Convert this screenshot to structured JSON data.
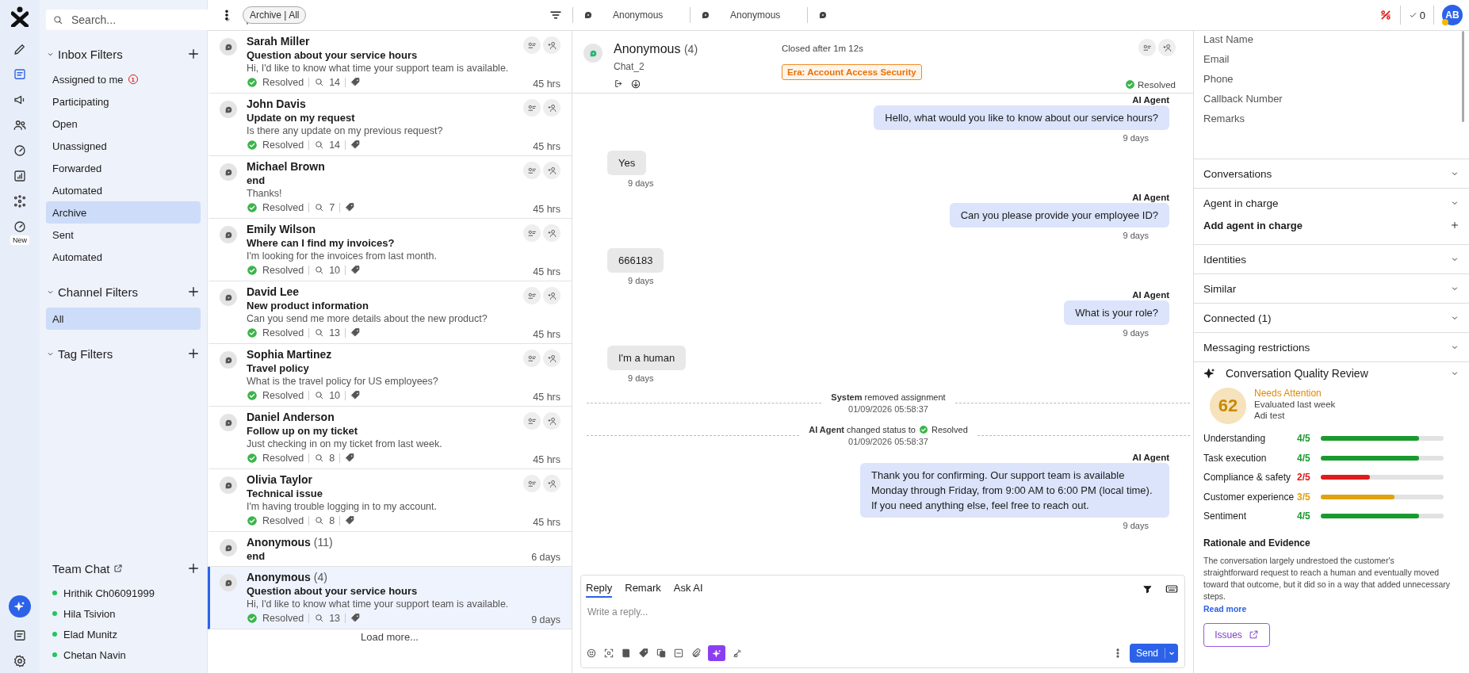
{
  "rail": {
    "items": [
      {
        "selected": false
      },
      {
        "selected": true
      },
      {
        "selected": false
      },
      {
        "selected": false
      },
      {
        "selected": false
      },
      {
        "selected": false
      },
      {
        "selected": false
      },
      {
        "selected": false,
        "badge": "New"
      }
    ]
  },
  "sidebar": {
    "search": {
      "placeholder": "Search..."
    },
    "sections": [
      {
        "title": "Inbox Filters",
        "items": [
          {
            "label": "Assigned to me",
            "badge": "1",
            "selected": false
          },
          {
            "label": "Participating",
            "selected": false
          },
          {
            "label": "Open",
            "selected": false
          },
          {
            "label": "Unassigned",
            "selected": false
          },
          {
            "label": "Forwarded",
            "selected": false
          },
          {
            "label": "Automated",
            "selected": false
          },
          {
            "label": "Archive",
            "selected": true
          },
          {
            "label": "Sent",
            "selected": false
          },
          {
            "label": "Automated",
            "selected": false
          }
        ]
      },
      {
        "title": "Channel Filters",
        "items": [
          {
            "label": "All",
            "selected": true
          }
        ]
      },
      {
        "title": "Tag Filters"
      }
    ],
    "team_chat": {
      "title": "Team Chat",
      "members": [
        {
          "name": "Hrithik Ch06091999",
          "online": true
        },
        {
          "name": "Hila Tsivion",
          "online": true
        },
        {
          "name": "Elad Munitz",
          "online": true
        },
        {
          "name": "Chetan Navin",
          "online": true
        }
      ]
    }
  },
  "topbar": {
    "scope": "Archive | All",
    "tabs": [
      {
        "label": "Anonymous"
      },
      {
        "label": "Anonymous"
      }
    ],
    "done_count": "0",
    "avatar": "AB"
  },
  "conversations": {
    "items": [
      {
        "name": "Sarah Miller",
        "subject": "Question about your service hours",
        "preview": "Hi, I'd like to know what time your support team is available.",
        "status": "Resolved",
        "messages": "14",
        "time": "45 hrs",
        "selected": false
      },
      {
        "name": "John Davis",
        "subject": "Update on my request",
        "preview": "Is there any update on my previous request?",
        "status": "Resolved",
        "messages": "14",
        "time": "45 hrs",
        "selected": false
      },
      {
        "name": "Michael Brown",
        "subject": "end",
        "preview": "Thanks!",
        "status": "Resolved",
        "messages": "7",
        "time": "45 hrs",
        "selected": false
      },
      {
        "name": "Emily Wilson",
        "subject": "Where can I find my invoices?",
        "preview": "I'm looking for the invoices from last month.",
        "status": "Resolved",
        "messages": "10",
        "time": "45 hrs",
        "selected": false
      },
      {
        "name": "David Lee",
        "subject": "New product information",
        "preview": "Can you send me more details about the new product?",
        "status": "Resolved",
        "messages": "13",
        "time": "45 hrs",
        "selected": false
      },
      {
        "name": "Sophia Martinez",
        "subject": "Travel policy",
        "preview": "What is the travel policy for US employees?",
        "status": "Resolved",
        "messages": "10",
        "time": "45 hrs",
        "selected": false
      },
      {
        "name": "Daniel Anderson",
        "subject": "Follow up on my ticket",
        "preview": "Just checking in on my ticket from last week.",
        "status": "Resolved",
        "messages": "8",
        "time": "45 hrs",
        "selected": false
      },
      {
        "name": "Olivia Taylor",
        "subject": "Technical issue",
        "preview": "I'm having trouble logging in to my account.",
        "status": "Resolved",
        "messages": "8",
        "time": "45 hrs",
        "selected": false
      },
      {
        "name": "Anonymous",
        "count": "(11)",
        "subject": "end",
        "time": "6 days",
        "selected": false
      },
      {
        "name": "Anonymous",
        "count": "(4)",
        "subject": "Question about your service hours",
        "preview": "Hi, I'd like to know what time your support team is available.",
        "status": "Resolved",
        "messages": "13",
        "time": "9 days",
        "selected": true
      }
    ],
    "load_more": "Load more..."
  },
  "chat": {
    "header": {
      "name": "Anonymous",
      "count": "(4)",
      "channel": "Chat_2",
      "closed": "Closed after 1m 12s",
      "tag": "Era: Account Access Security",
      "status": "Resolved"
    },
    "messages": [
      {
        "kind": "bot",
        "sender": "AI Agent",
        "text": "Hello, what would you like to know about our service hours?",
        "time": "9 days"
      },
      {
        "kind": "user",
        "text": "Yes",
        "time": "9 days"
      },
      {
        "kind": "bot",
        "sender": "AI Agent",
        "text": "Can you please provide your employee ID?",
        "time": "9 days"
      },
      {
        "kind": "user",
        "text": "666183",
        "time": "9 days"
      },
      {
        "kind": "bot",
        "sender": "AI Agent",
        "text": "What is your role?",
        "time": "9 days"
      },
      {
        "kind": "user",
        "text": "I'm a human",
        "time": "9 days"
      },
      {
        "kind": "event",
        "text": "**System** removed assignment",
        "date": "01/09/2026 05:58:37"
      },
      {
        "kind": "event",
        "text": "**AI Agent** changed status to",
        "status": "Resolved",
        "date": "01/09/2026 05:58:37"
      },
      {
        "kind": "bot",
        "sender": "AI Agent",
        "text": "Thank you for confirming. Our support team is available Monday through Friday, from 9:00 AM to 6:00 PM (local time). If you need anything else, feel free to reach out.",
        "time": "9 days"
      }
    ],
    "composer": {
      "tabs": [
        {
          "label": "Reply",
          "selected": true
        },
        {
          "label": "Remark",
          "selected": false
        },
        {
          "label": "Ask AI",
          "selected": false
        }
      ],
      "placeholder": "Write a reply...",
      "send": "Send"
    }
  },
  "details": {
    "fields": [
      "Last Name",
      "Email",
      "Phone",
      "Callback Number",
      "Remarks"
    ],
    "sections": [
      {
        "title": "Conversations"
      },
      {
        "title": "Agent in charge",
        "action": "Add agent in charge"
      },
      {
        "title": "Identities"
      },
      {
        "title": "Similar"
      },
      {
        "title": "Connected (1)"
      },
      {
        "title": "Messaging restrictions"
      }
    ],
    "quality": {
      "title": "Conversation Quality Review",
      "score": "62",
      "rating": "Needs Attention",
      "evaluated": "Evaluated last week",
      "evaluator": "Adi test",
      "metrics": [
        {
          "label": "Understanding",
          "score": "4/5",
          "level": 0.8,
          "color": "#1a9a2e"
        },
        {
          "label": "Task execution",
          "score": "4/5",
          "level": 0.8,
          "color": "#1a9a2e"
        },
        {
          "label": "Compliance & safety",
          "score": "2/5",
          "level": 0.4,
          "color": "#e01b1b"
        },
        {
          "label": "Customer experience",
          "score": "3/5",
          "level": 0.6,
          "color": "#e0a20e"
        },
        {
          "label": "Sentiment",
          "score": "4/5",
          "level": 0.8,
          "color": "#1a9a2e"
        }
      ],
      "rationale_title": "Rationale and Evidence",
      "rationale": "The conversation largely undrestoed the customer's straightforward request to reach a human and eventually moved toward that outcome, but it did so in a way that added unnecessary steps.",
      "read_more": "Read more",
      "issues": "Issues"
    }
  }
}
